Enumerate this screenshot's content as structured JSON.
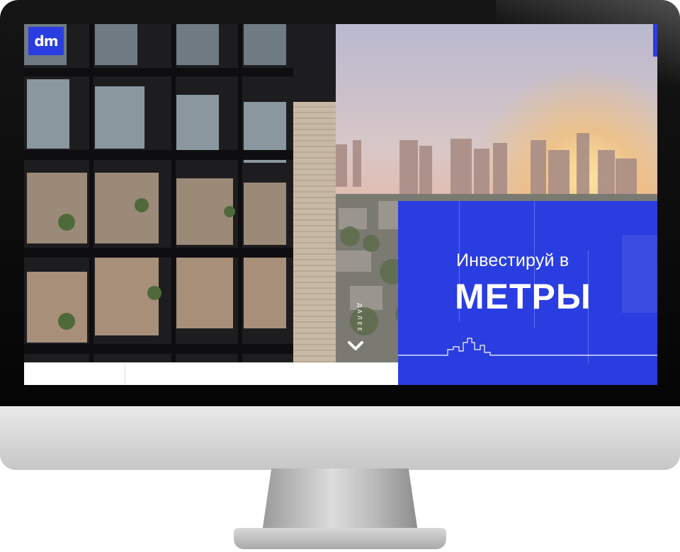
{
  "logo": {
    "text": "dm"
  },
  "hero": {
    "subtitle": "Инвестируй в",
    "title": "МЕТРЫ"
  },
  "scroll_hint": {
    "label": "ДАЛЕЕ"
  },
  "colors": {
    "brand_blue": "#2a3de0",
    "white": "#ffffff"
  },
  "icons": {
    "scroll_down": "chevron-down-icon"
  }
}
